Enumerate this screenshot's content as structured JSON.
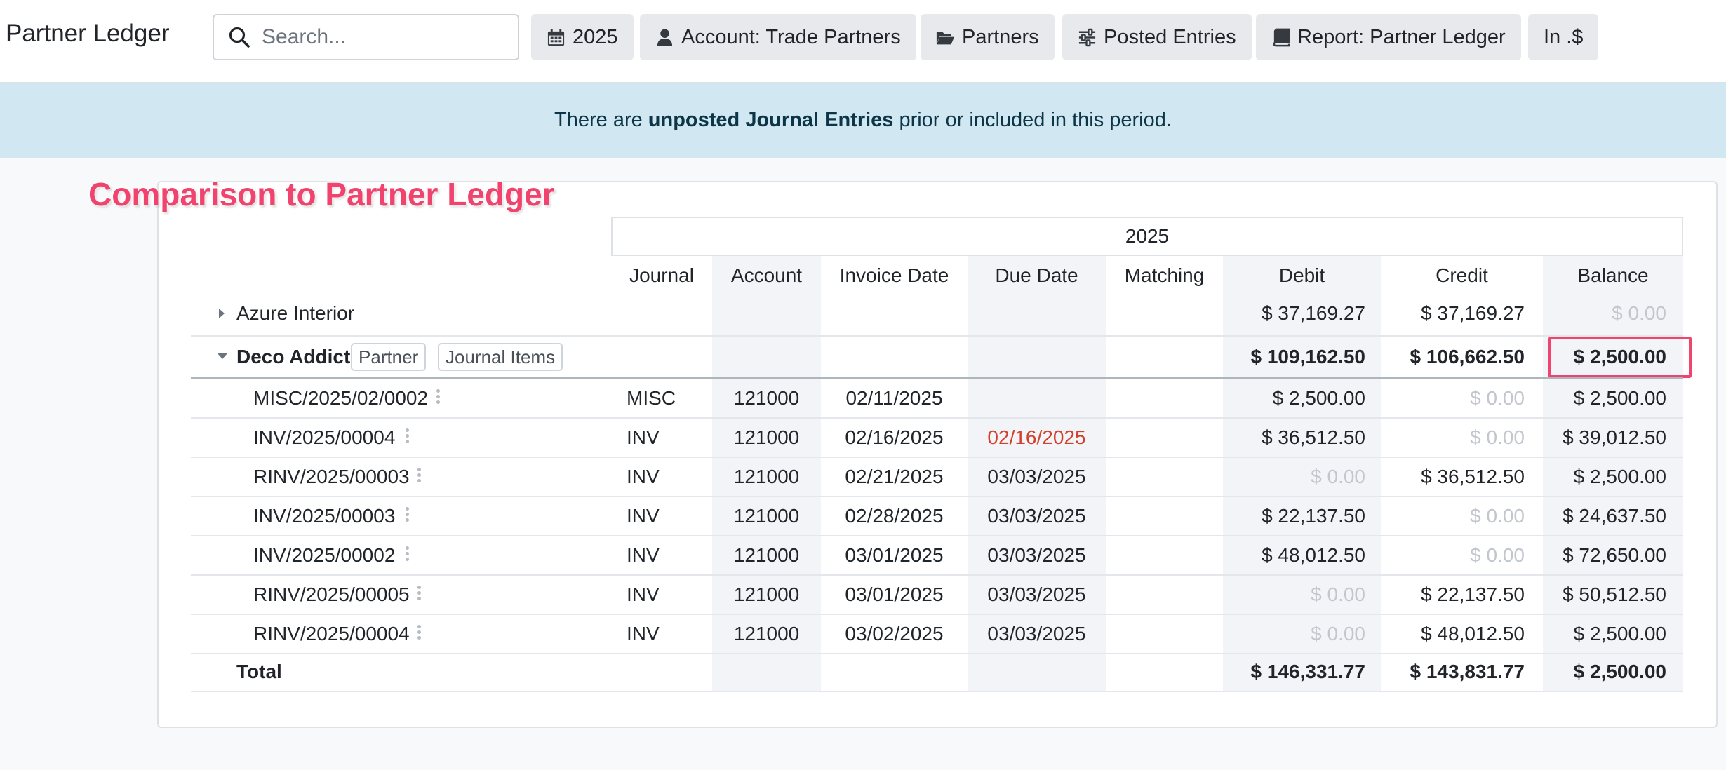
{
  "header": {
    "title": "Partner Ledger",
    "search_placeholder": "Search...",
    "filters": [
      {
        "label": "2025",
        "icon": "calendar-icon"
      },
      {
        "label": "Account: Trade Partners",
        "icon": "user-icon"
      },
      {
        "label": "Partners",
        "icon": "folder-open-icon"
      },
      {
        "label": "Posted Entries",
        "icon": "sliders-icon"
      },
      {
        "label": "Report: Partner Ledger",
        "icon": "book-icon"
      },
      {
        "label": "In .$",
        "icon": ""
      }
    ]
  },
  "alert": {
    "prefix": "There are",
    "bold": "unposted Journal Entries",
    "suffix": "prior or included in this period."
  },
  "annotation": {
    "title": "Comparison to Partner Ledger",
    "color": "#f0446f"
  },
  "report": {
    "period": "2025",
    "columns": [
      "Journal",
      "Account",
      "Invoice Date",
      "Due Date",
      "Matching",
      "Debit",
      "Credit",
      "Balance"
    ],
    "partners": [
      {
        "name": "Azure Interior",
        "expanded": false,
        "debit": "$ 37,169.27",
        "credit": "$ 37,169.27",
        "balance": "$ 0.00"
      },
      {
        "name": "Deco Addict",
        "expanded": true,
        "debit": "$ 109,162.50",
        "credit": "$ 106,662.50",
        "balance": "$ 2,500.00",
        "badges": [
          "Partner",
          "Journal Items"
        ]
      }
    ],
    "lines": [
      {
        "ref": "MISC/2025/02/0002",
        "journal": "MISC",
        "account": "121000",
        "invoice_date": "02/11/2025",
        "due_date": "",
        "overdue": false,
        "debit": "$ 2,500.00",
        "credit": "$ 0.00",
        "balance": "$ 2,500.00"
      },
      {
        "ref": "INV/2025/00004",
        "journal": "INV",
        "account": "121000",
        "invoice_date": "02/16/2025",
        "due_date": "02/16/2025",
        "overdue": true,
        "debit": "$ 36,512.50",
        "credit": "$ 0.00",
        "balance": "$ 39,012.50"
      },
      {
        "ref": "RINV/2025/00003",
        "journal": "INV",
        "account": "121000",
        "invoice_date": "02/21/2025",
        "due_date": "03/03/2025",
        "overdue": false,
        "debit": "$ 0.00",
        "credit": "$ 36,512.50",
        "balance": "$ 2,500.00"
      },
      {
        "ref": "INV/2025/00003",
        "journal": "INV",
        "account": "121000",
        "invoice_date": "02/28/2025",
        "due_date": "03/03/2025",
        "overdue": false,
        "debit": "$ 22,137.50",
        "credit": "$ 0.00",
        "balance": "$ 24,637.50"
      },
      {
        "ref": "INV/2025/00002",
        "journal": "INV",
        "account": "121000",
        "invoice_date": "03/01/2025",
        "due_date": "03/03/2025",
        "overdue": false,
        "debit": "$ 48,012.50",
        "credit": "$ 0.00",
        "balance": "$ 72,650.00"
      },
      {
        "ref": "RINV/2025/00005",
        "journal": "INV",
        "account": "121000",
        "invoice_date": "03/01/2025",
        "due_date": "03/03/2025",
        "overdue": false,
        "debit": "$ 0.00",
        "credit": "$ 22,137.50",
        "balance": "$ 50,512.50"
      },
      {
        "ref": "RINV/2025/00004",
        "journal": "INV",
        "account": "121000",
        "invoice_date": "03/02/2025",
        "due_date": "03/03/2025",
        "overdue": false,
        "debit": "$ 0.00",
        "credit": "$ 48,012.50",
        "balance": "$ 2,500.00"
      }
    ],
    "total": {
      "label": "Total",
      "debit": "$ 146,331.77",
      "credit": "$ 143,831.77",
      "balance": "$ 2,500.00"
    }
  }
}
